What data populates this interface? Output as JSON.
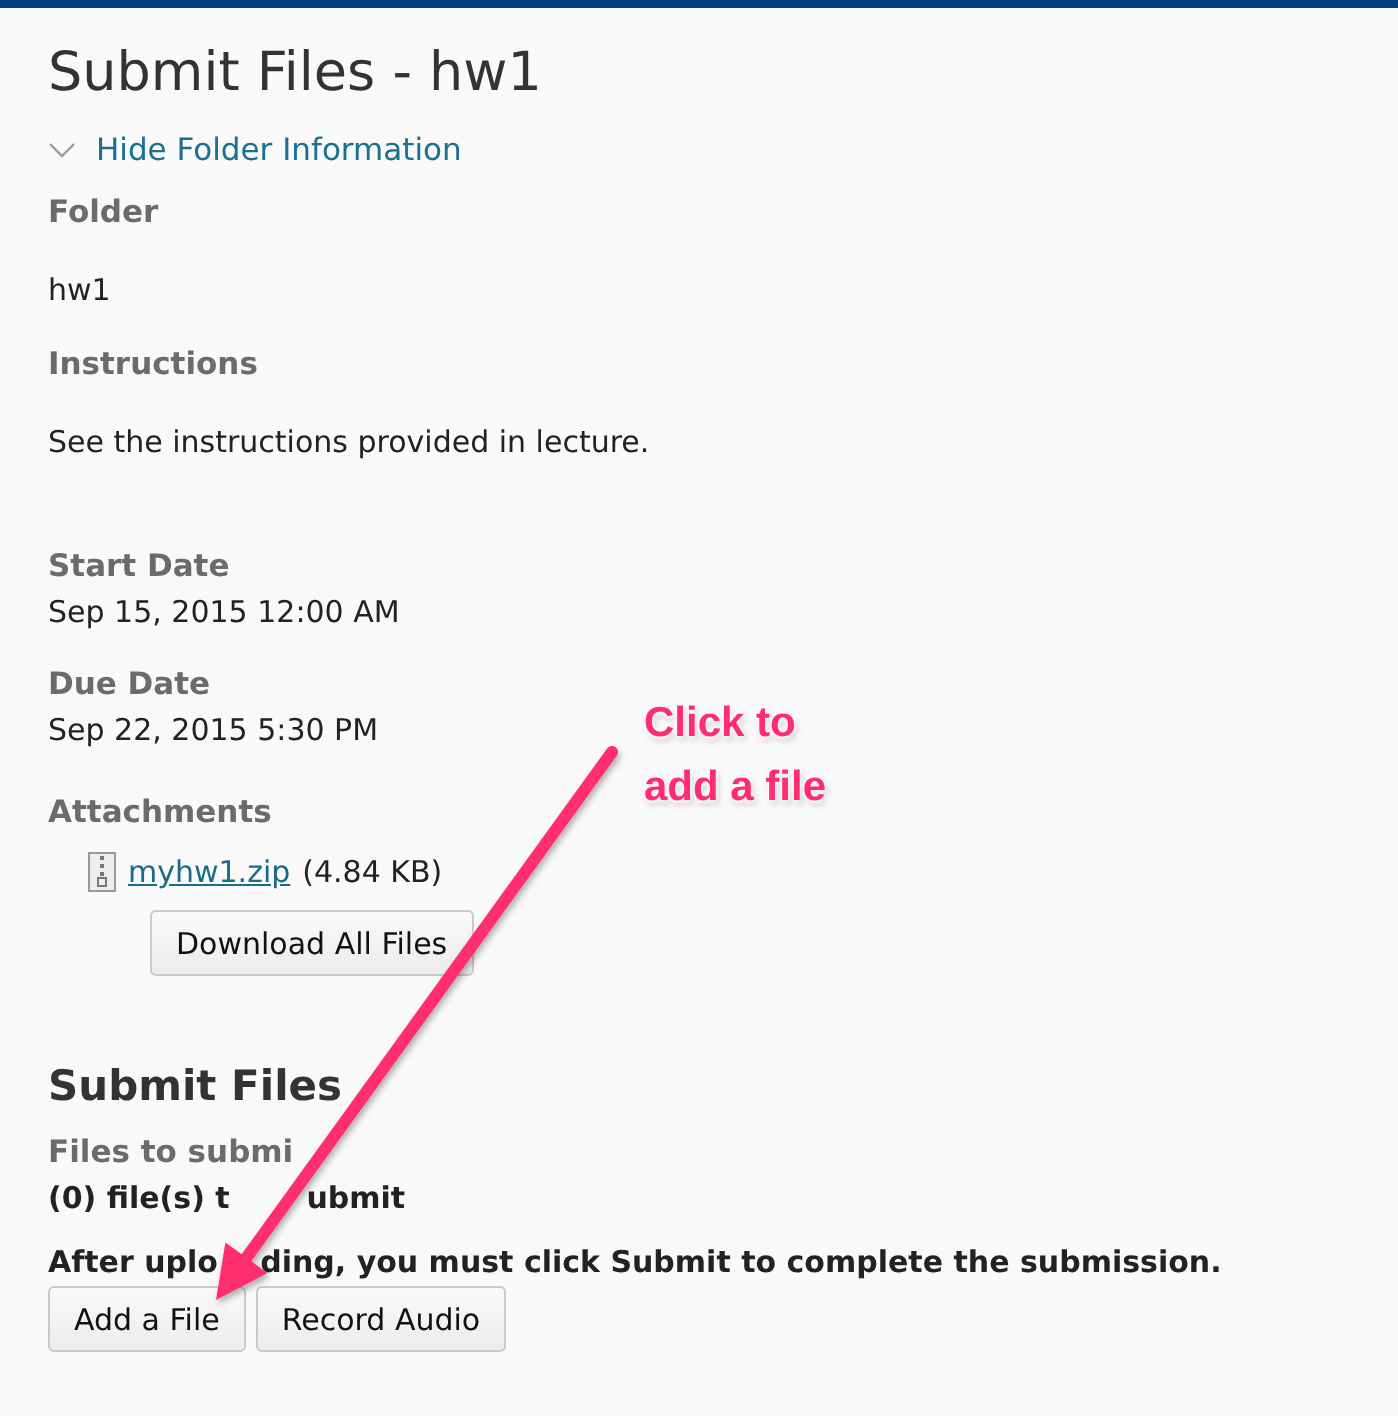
{
  "page": {
    "title": "Submit Files - hw1",
    "toggle": {
      "label": "Hide Folder Information",
      "expanded": true
    }
  },
  "folder_info": [
    {
      "label": "Folder",
      "value": "hw1",
      "kind": "spaced"
    },
    {
      "label": "Instructions",
      "value": "See the instructions provided in lecture.",
      "kind": "spaced"
    },
    {
      "label": "Start Date",
      "value": "Sep 15, 2015 12:00 AM",
      "kind": "tight"
    },
    {
      "label": "Due Date",
      "value": "Sep 22, 2015 5:30 PM",
      "kind": "tight"
    }
  ],
  "attachments": {
    "label": "Attachments",
    "files": [
      {
        "name": "myhw1.zip",
        "size": "(4.84 KB)"
      }
    ],
    "button": "Download All Files"
  },
  "submit": {
    "heading": "Submit Files",
    "files_label": "Files to submi",
    "count_parts": [
      "(0) file(s) t",
      "ubmit"
    ],
    "note_parts": [
      "After uplo",
      "ding, you must click Submit to complete the submission."
    ],
    "buttons": [
      "Add a File",
      "Record Audio"
    ]
  },
  "callout": {
    "lines": [
      "Click to",
      "add a file"
    ]
  }
}
